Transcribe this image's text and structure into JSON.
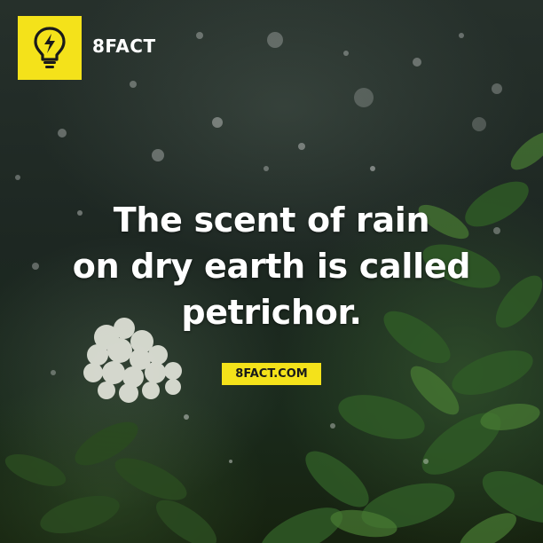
{
  "brand": {
    "name": "8FACT",
    "logo_icon": "lightbulb-bolt-icon",
    "accent_color": "#f4e21a"
  },
  "fact": {
    "lines": [
      "The scent of rain",
      "on dry earth is called",
      "petrichor."
    ]
  },
  "footer": {
    "url": "8FACT.COM"
  }
}
